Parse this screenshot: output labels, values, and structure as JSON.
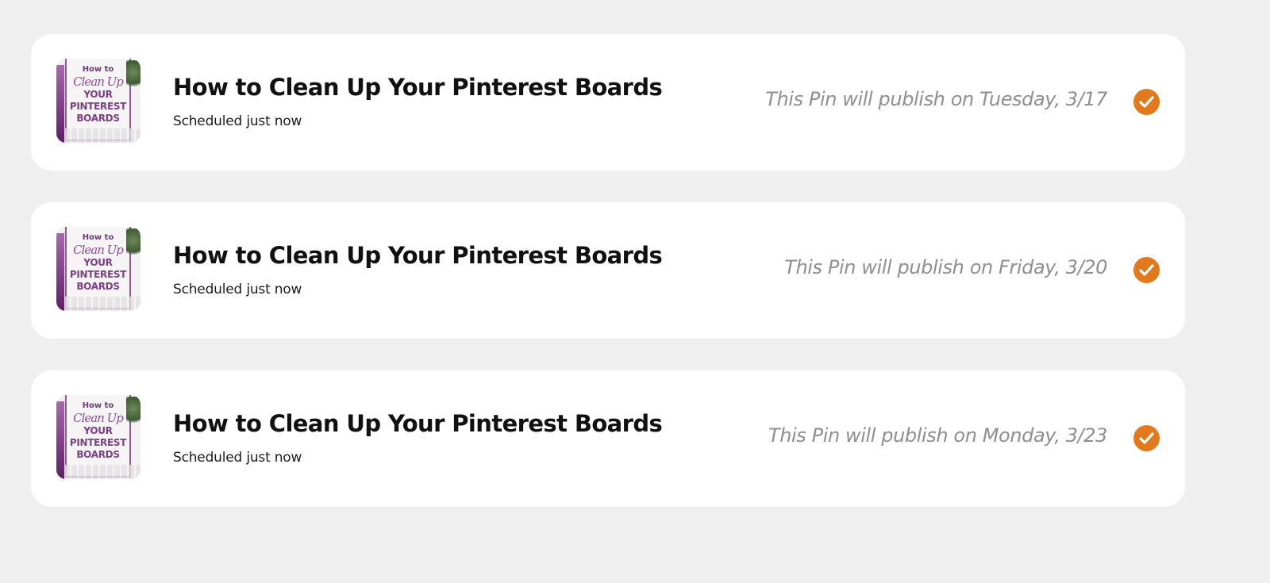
{
  "colors": {
    "background": "#efefef",
    "card": "#ffffff",
    "accent": "#e2791c",
    "publish_text": "#8f8f8f"
  },
  "pins": [
    {
      "thumbnail": {
        "line1": "How to",
        "line2": "Clean Up",
        "line3": "YOUR",
        "line4": "PINTEREST",
        "line5": "BOARDS"
      },
      "title": "How to Clean Up Your Pinterest Boards",
      "status": "Scheduled just now",
      "publish_text": "This Pin will publish on Tuesday, 3/17",
      "icon": "check-circle-icon"
    },
    {
      "thumbnail": {
        "line1": "How to",
        "line2": "Clean Up",
        "line3": "YOUR",
        "line4": "PINTEREST",
        "line5": "BOARDS"
      },
      "title": "How to Clean Up Your Pinterest Boards",
      "status": "Scheduled just now",
      "publish_text": "This Pin will publish on Friday, 3/20",
      "icon": "check-circle-icon"
    },
    {
      "thumbnail": {
        "line1": "How to",
        "line2": "Clean Up",
        "line3": "YOUR",
        "line4": "PINTEREST",
        "line5": "BOARDS"
      },
      "title": "How to Clean Up Your Pinterest Boards",
      "status": "Scheduled just now",
      "publish_text": "This Pin will publish on Monday, 3/23",
      "icon": "check-circle-icon"
    }
  ]
}
